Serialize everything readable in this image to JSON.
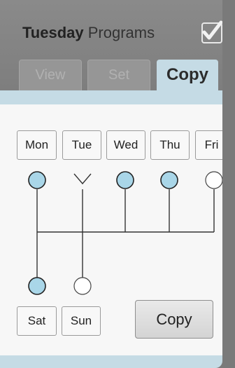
{
  "header": {
    "day": "Tuesday",
    "title_rest": "Programs"
  },
  "tabs": [
    {
      "label": "View",
      "active": false
    },
    {
      "label": "Set",
      "active": false
    },
    {
      "label": "Copy",
      "active": true
    }
  ],
  "days_top": [
    "Mon",
    "Tue",
    "Wed",
    "Thu",
    "Fri"
  ],
  "days_bottom": [
    "Sat",
    "Sun"
  ],
  "selection": {
    "source": "Tue",
    "selected": [
      "Mon",
      "Wed",
      "Thu",
      "Sat"
    ],
    "unselected": [
      "Fri",
      "Sun"
    ]
  },
  "colors": {
    "selected": "#a9d6e8",
    "unselected": "#ffffff",
    "accent": "#c5dbe5"
  },
  "action": {
    "copy_label": "Copy"
  },
  "icons": {
    "confirm": "checkmark-icon"
  }
}
